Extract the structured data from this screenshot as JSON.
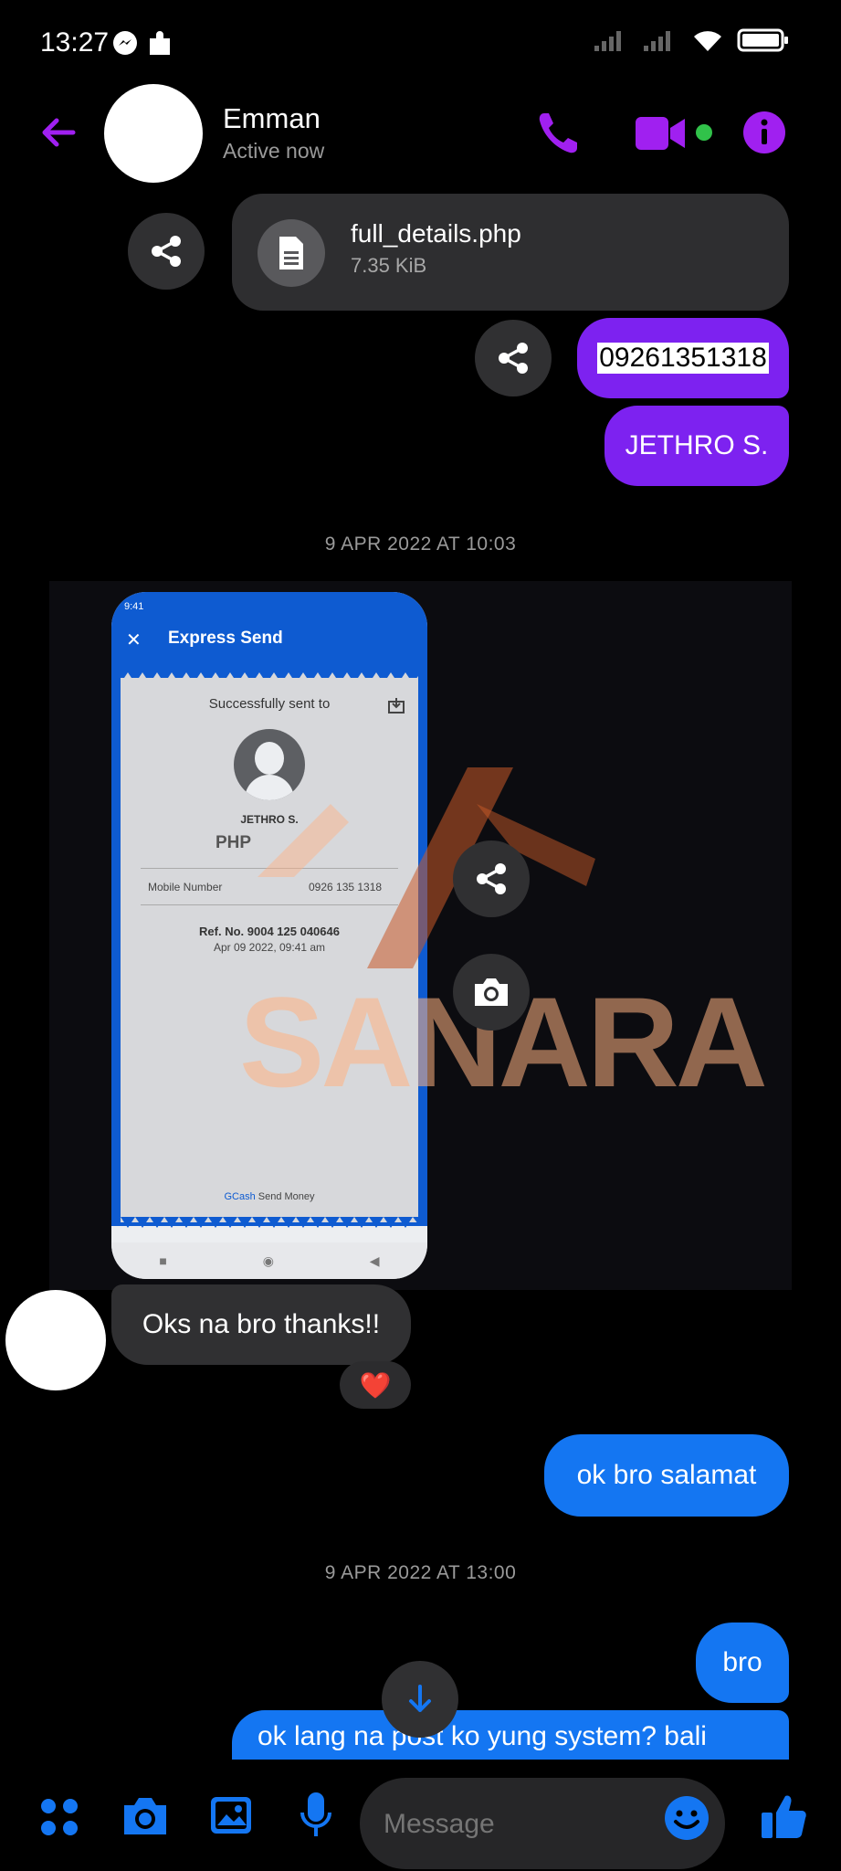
{
  "status_bar": {
    "time": "13:27"
  },
  "header": {
    "name": "Emman",
    "status": "Active now"
  },
  "file": {
    "name": "full_details.php",
    "size": "7.35 KiB"
  },
  "sent_number": "09261351318",
  "sent_name": "JETHRO S.",
  "timestamp_1": "9 APR 2022 AT 10:03",
  "receipt": {
    "phone_time": "9:41",
    "title": "Express Send",
    "success": "Successfully sent to",
    "recipient": "JETHRO S.",
    "currency": "PHP",
    "mobile_label": "Mobile Number",
    "mobile_value": "0926 135 1318",
    "ref": "Ref. No. 9004 125 040646",
    "date": "Apr 09 2022, 09:41 am",
    "footer_brand": "GCash",
    "footer_text": "Send Money"
  },
  "watermark": "SANARA",
  "received_message": "Oks na bro thanks!!",
  "reaction": "❤️",
  "sent_message_1": "ok bro salamat",
  "timestamp_2": "9 APR 2022 AT 13:00",
  "sent_message_2": "bro",
  "sent_message_3": "ok lang na post ko yung system? bali",
  "compose": {
    "placeholder": "Message"
  },
  "colors": {
    "accent_purple": "#7d22f0",
    "accent_blue": "#1476f2",
    "header_icon": "#a020f0"
  }
}
